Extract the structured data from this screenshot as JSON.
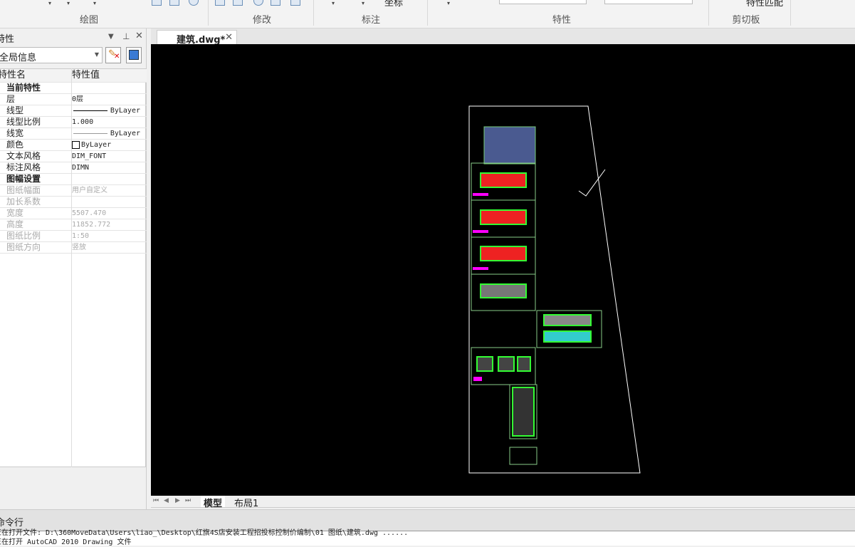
{
  "ribbon": {
    "groups": [
      "绘图",
      "修改",
      "标注",
      "特性",
      "剪切板"
    ],
    "coord_label": "坐标",
    "match_label": "特性匹配"
  },
  "properties_panel": {
    "title": "特性",
    "combo_value": "全局信息",
    "header": {
      "name": "特性名",
      "value": "特性值"
    },
    "rows": [
      {
        "type": "section",
        "name": "当前特性"
      },
      {
        "name": "层",
        "value": "0层"
      },
      {
        "name": "线型",
        "value": "ByLayer"
      },
      {
        "name": "线型比例",
        "value": "1.000"
      },
      {
        "name": "线宽",
        "value": "ByLayer"
      },
      {
        "name": "颜色",
        "value": "ByLayer"
      },
      {
        "name": "文本风格",
        "value": "DIM_FONT"
      },
      {
        "name": "标注风格",
        "value": "DIMN"
      },
      {
        "type": "section",
        "name": "图幅设置"
      },
      {
        "name": "图纸幅面",
        "value": "用户自定义",
        "disabled": true
      },
      {
        "name": "加长系数",
        "value": "",
        "disabled": true
      },
      {
        "name": "宽度",
        "value": "5507.470",
        "disabled": true
      },
      {
        "name": "高度",
        "value": "11852.772",
        "disabled": true
      },
      {
        "name": "图纸比例",
        "value": "1:50",
        "disabled": true
      },
      {
        "name": "图纸方向",
        "value": "竖放",
        "disabled": true
      }
    ]
  },
  "document": {
    "tab_label": "建筑.dwg*"
  },
  "layout_tabs": [
    "模型",
    "布局1"
  ],
  "command": {
    "title": "命令行",
    "lines": [
      "正在打开文件: D:\\360MoveData\\Users\\liao_\\Desktop\\红旗4S店安装工程招投标控制价编制\\01 图纸\\建筑.dwg ......",
      "正在打开 AutoCAD 2010 Drawing 文件"
    ]
  }
}
